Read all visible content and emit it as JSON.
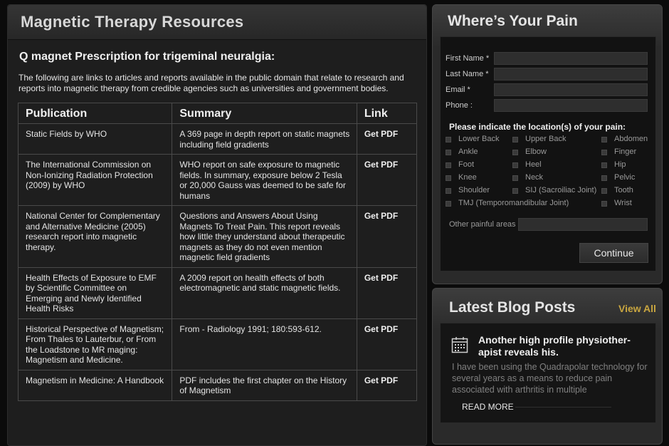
{
  "left": {
    "title": "Magnetic Therapy Resources",
    "subheading": "Q magnet Prescription for trigeminal neuralgia:",
    "intro": "The following are links to articles and reports available in the public domain that relate to research and reports into magnetic therapy from credible agencies such as universities and government bodies.",
    "table": {
      "headers": [
        "Publication",
        "Summary",
        "Link"
      ],
      "rows": [
        {
          "publication": "Static Fields by WHO",
          "summary": "A 369 page in depth report on static magnets including field gradients",
          "link": "Get PDF"
        },
        {
          "publication": "The International Commission on Non-Ionizing Radiation Protection (2009) by WHO",
          "summary": "WHO report on safe exposure to magnetic fields. In summary, exposure below 2 Tesla or 20,000 Gauss was deemed to be safe for humans",
          "link": "Get PDF"
        },
        {
          "publication": "National Center for Complementary and Alternative Medicine (2005) research report into magnetic therapy.",
          "summary": "Questions and Answers About Using Magnets To Treat Pain. This report reveals how little they understand about therapeutic magnets as they do not even mention magnetic field gradients",
          "link": "Get PDF"
        },
        {
          "publication": "Health Effects of Exposure to EMF by Scientific Committee on Emerging and Newly Identified Health Risks",
          "summary": "A 2009 report on health effects of both electromagnetic and static magnetic fields.",
          "link": "Get PDF"
        },
        {
          "publication": "Historical Perspective of Magnetism; From Thales to Lauterbur, or From the Loadstone to MR maging: Magnetism and Medicine.",
          "summary": "From - Radiology 1991; 180:593-612.",
          "link": "Get PDF"
        },
        {
          "publication": "Magnetism in Medicine: A Handbook",
          "summary": "PDF includes the first chapter on the History of Magnetism",
          "link": "Get PDF"
        }
      ]
    }
  },
  "pain_form": {
    "title": "Where’s Your Pain",
    "fields": [
      {
        "label": "First Name *",
        "value": ""
      },
      {
        "label": "Last Name *",
        "value": ""
      },
      {
        "label": "Email *",
        "value": ""
      },
      {
        "label": "Phone :",
        "value": ""
      }
    ],
    "locations_title": "Please indicate the location(s) of your pain:",
    "locations": [
      "Lower Back",
      "Upper Back",
      "Abdomen",
      "Ankle",
      "Elbow",
      "Finger",
      "Foot",
      "Heel",
      "Hip",
      "Knee",
      "Neck",
      "Pelvic",
      "Shoulder",
      "SIJ (Sacroiliac Joint)",
      "Tooth",
      "TMJ (Temporomandibular Joint)",
      "Wrist"
    ],
    "other_label": "Other painful areas",
    "other_value": "",
    "continue_label": "Continue"
  },
  "blog": {
    "title": "Latest Blog Posts",
    "view_all": "View All",
    "post": {
      "title": "Another high profile physiother-apist reveals his.",
      "excerpt": "I have been using the Quadrapolar technology for several years as a means to reduce pain associated with arthritis in multiple",
      "read_more": "READ MORE"
    }
  },
  "colors": {
    "accent_gold": "#c9a640",
    "panel_bg": "#1e1e1e",
    "form_bg": "#121212"
  }
}
